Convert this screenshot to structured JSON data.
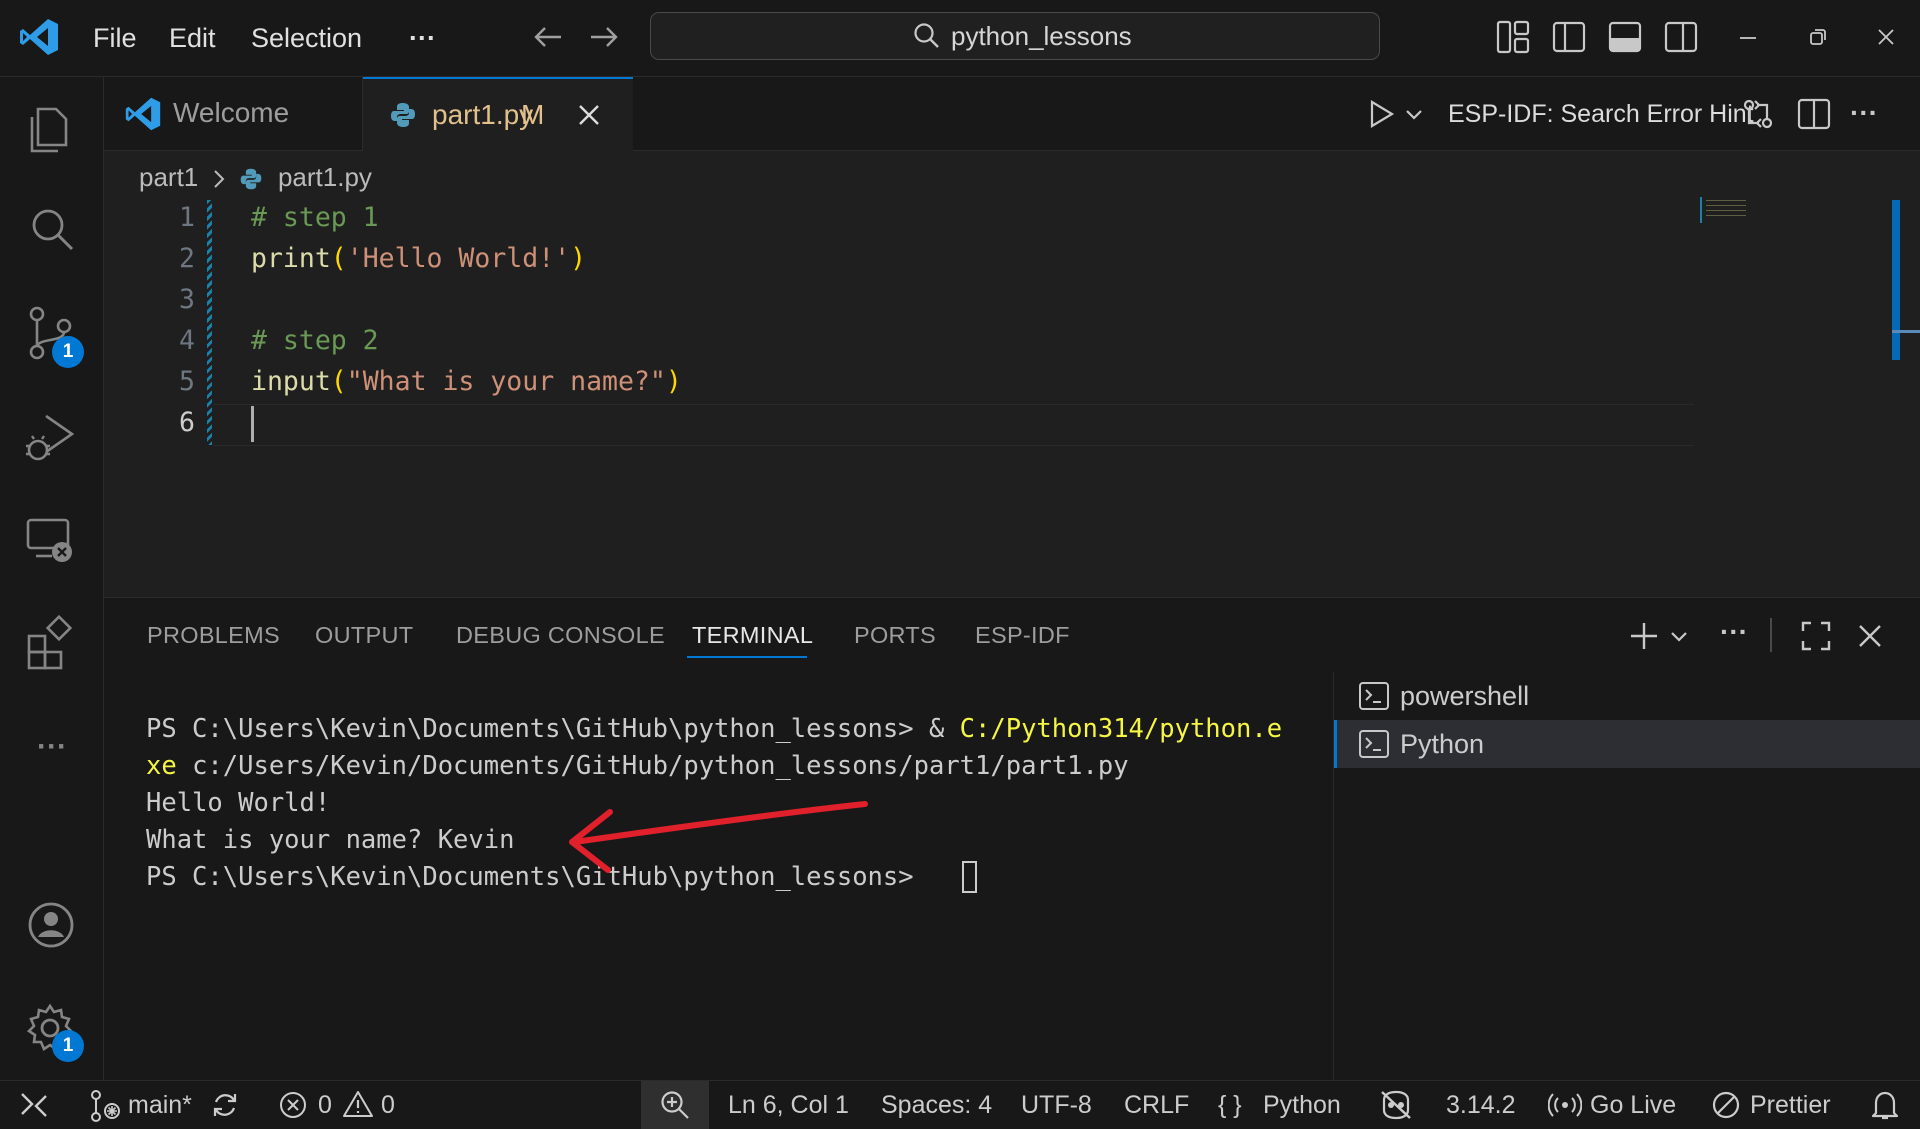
{
  "titlebar": {
    "menu": [
      "File",
      "Edit",
      "Selection"
    ],
    "more": "···",
    "search": "python_lessons"
  },
  "activity": {
    "source_control_badge": "1",
    "settings_badge": "1",
    "more": "···"
  },
  "tabs": [
    {
      "label": "Welcome"
    },
    {
      "label": "part1.py",
      "status": "M"
    }
  ],
  "editor_actions": {
    "search_error_hint": "ESP-IDF: Search Error Hint"
  },
  "breadcrumb": {
    "folder": "part1",
    "file": "part1.py"
  },
  "code": {
    "line_numbers": [
      "1",
      "2",
      "3",
      "4",
      "5",
      "6"
    ],
    "line1_comment": "# step 1",
    "line2_func": "print",
    "line2_open": "(",
    "line2_str": "'Hello World!'",
    "line2_close": ")",
    "line4_comment": "# step 2",
    "line5_func": "input",
    "line5_open": "(",
    "line5_str": "\"What is your name?\"",
    "line5_close": ")"
  },
  "panel": {
    "tabs": [
      "PROBLEMS",
      "OUTPUT",
      "DEBUG CONSOLE",
      "TERMINAL",
      "PORTS",
      "ESP-IDF"
    ],
    "active_tab": "TERMINAL",
    "more": "···"
  },
  "terminal": {
    "line1_prompt": "PS C:\\Users\\Kevin\\Documents\\GitHub\\python_lessons> & ",
    "line1_exe": "C:/Python314/python.e",
    "line2_exe": "xe",
    "line2_rest": " c:/Users/Kevin/Documents/GitHub/python_lessons/part1/part1.py",
    "line3": "Hello World!",
    "line4": "What is your name? Kevin",
    "line5_prompt": "PS C:\\Users\\Kevin\\Documents\\GitHub\\python_lessons> "
  },
  "terminal_list": [
    {
      "label": "powershell"
    },
    {
      "label": "Python"
    }
  ],
  "statusbar": {
    "branch": "main*",
    "errors": "0",
    "warnings": "0",
    "position": "Ln 6, Col 1",
    "spaces": "Spaces: 4",
    "encoding": "UTF-8",
    "eol": "CRLF",
    "lang_braces": "{ }",
    "language": "Python",
    "version": "3.14.2",
    "go_live": "Go Live",
    "prettier": "Prettier"
  },
  "colors": {
    "accent": "#0078d4",
    "arrow": "#e0202a"
  }
}
